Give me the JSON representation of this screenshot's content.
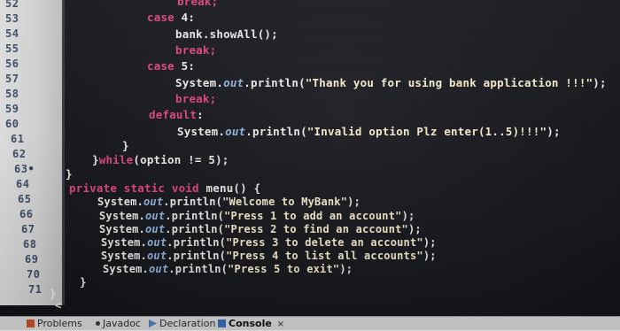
{
  "editor": {
    "line_numbers": [
      "52",
      "53",
      "54",
      "55",
      "56",
      "57",
      "58",
      "59",
      "60",
      "61",
      "62",
      "63",
      "64",
      "65",
      "66",
      "67",
      "68",
      "69",
      "70",
      "71"
    ],
    "fold_marker": "•",
    "lines": {
      "l52_kw": "break;",
      "l53_kw": "case",
      "l53_rest": " 4:",
      "l54_obj": "bank.showAll();",
      "l55_kw": "break;",
      "l56_kw": "case",
      "l56_rest": " 5:",
      "l57_cls": "System.",
      "l57_fld": "out",
      "l57_mid": ".println(",
      "l57_str": "\"Thank you for using bank application !!!\"",
      "l57_end": ");",
      "l58_kw": "break;",
      "l59_kw": "default",
      "l59_rest": ":",
      "l60_cls": "System.",
      "l60_fld": "out",
      "l60_mid": ".println(",
      "l60_str": "\"Invalid option Plz enter(1..5)!!!\"",
      "l60_end": ");",
      "l61_brace": "}",
      "l62_a": "}",
      "l62_kw": "while",
      "l62_rest": "(option != 5);",
      "l63_brace": "}",
      "l64_kw": "private static void",
      "l64_rest": " menu() {",
      "println_cls": "System.",
      "println_fld": "out",
      "println_mid": ".println(",
      "l65_str": "\"Welcome to MyBank\"",
      "l66_str": "\"Press 1 to add an account\"",
      "l67_str": "\"Press 2 to find an account\"",
      "l68_str": "\"Press 3 to delete an account\"",
      "l69_str": "\"Press 4 to list all accounts\"",
      "l70_str": "\"Press 5 to exit\"",
      "println_end": ");",
      "l71_brace": "}",
      "l72_brace": "}"
    },
    "horizontal_scroll_glyph": "<"
  },
  "bottom_tabs": {
    "problems": "Problems",
    "javadoc": "Javadoc",
    "declaration": "Declaration",
    "console": "Console",
    "close": "×"
  }
}
